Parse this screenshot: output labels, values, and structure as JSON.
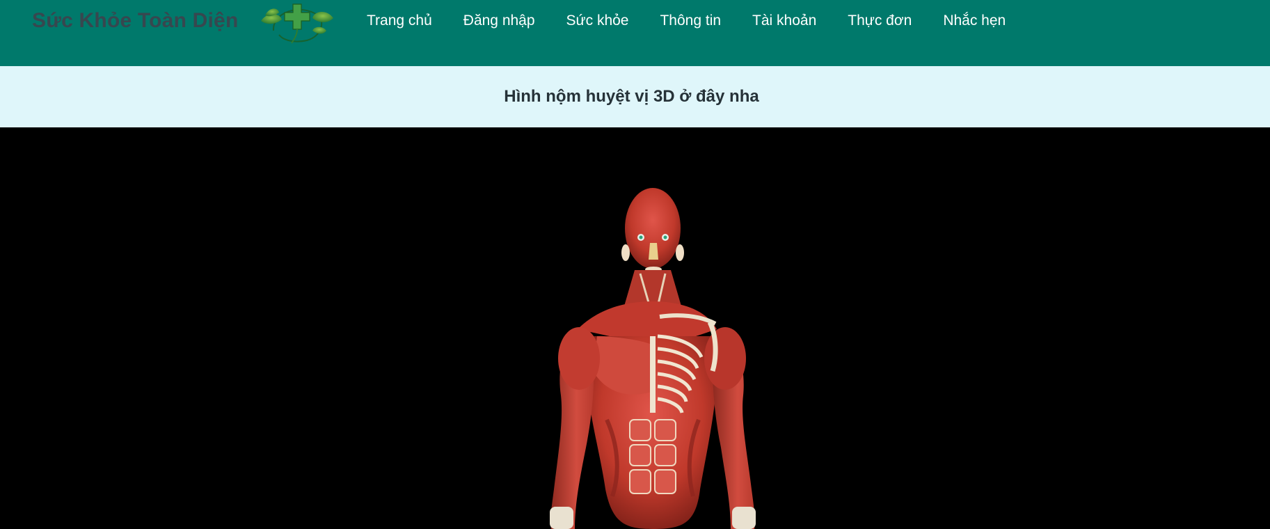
{
  "site": {
    "brand_name": "Sức Khỏe Toàn Diện",
    "logo_icon": "medical-cross-leaf-logo"
  },
  "nav": {
    "items": [
      {
        "label": "Trang chủ"
      },
      {
        "label": "Đăng nhập"
      },
      {
        "label": "Sức khỏe"
      },
      {
        "label": "Thông tin"
      },
      {
        "label": "Tài khoản"
      },
      {
        "label": "Thực đơn"
      },
      {
        "label": "Nhắc hẹn"
      }
    ]
  },
  "banner": {
    "title": "Hình nộm huyệt vị 3D ở đây nha"
  },
  "viewer": {
    "model_icon": "anatomy-muscle-model"
  },
  "colors": {
    "header_bg": "#00796b",
    "banner_bg": "#dff6fa",
    "viewer_bg": "#000000",
    "brand_text": "#37474f",
    "nav_text": "#ffffff"
  }
}
